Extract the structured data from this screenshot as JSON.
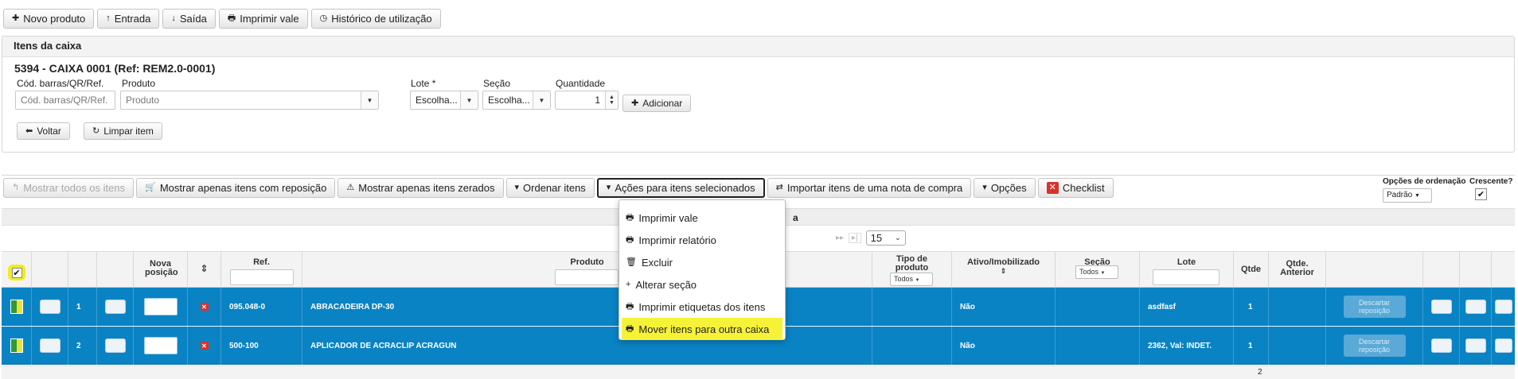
{
  "topbar": {
    "buttons": [
      {
        "icon": "plus-icon",
        "label": "Novo produto"
      },
      {
        "icon": "arrow-up-icon",
        "label": "Entrada"
      },
      {
        "icon": "arrow-down-icon",
        "label": "Saída"
      },
      {
        "icon": "printer-icon",
        "label": "Imprimir vale"
      },
      {
        "icon": "clock-icon",
        "label": "Histórico de utilização"
      }
    ]
  },
  "panel": {
    "title": "Itens da caixa",
    "box_title": "5394 - CAIXA 0001 (Ref: REM2.0-0001)",
    "barcode_label": "Cód. barras/QR/Ref.",
    "barcode_placeholder": "Cód. barras/QR/Ref.",
    "product_label": "Produto",
    "product_placeholder": "Produto",
    "lote_label": "Lote *",
    "lote_value": "Escolha...",
    "secao_label": "Seção",
    "secao_value": "Escolha...",
    "quantidade_label": "Quantidade",
    "quantidade_value": "1",
    "add_label": "Adicionar",
    "back_label": "Voltar",
    "clear_label": "Limpar item"
  },
  "toolbar": {
    "show_all": "Mostrar todos os itens",
    "show_replenish": "Mostrar apenas itens com reposição",
    "show_zero": "Mostrar apenas itens zerados",
    "order_items": "Ordenar itens",
    "actions": "Ações para itens selecionados",
    "import": "Importar itens de uma nota de compra",
    "options": "Opções",
    "checklist": "Checklist",
    "order_options_label": "Opções de ordenação",
    "order_options_value": "Padrão",
    "ascending_label": "Crescente?"
  },
  "menu": {
    "items": [
      {
        "icon": "printer-icon",
        "label": "Imprimir vale"
      },
      {
        "icon": "printer-icon",
        "label": "Imprimir relatório"
      },
      {
        "icon": "trash-icon",
        "label": "Excluir"
      },
      {
        "icon": "plus-icon",
        "label": "Alterar seção"
      },
      {
        "icon": "printer-icon",
        "label": "Imprimir etiquetas dos itens"
      },
      {
        "icon": "printer-icon",
        "label": "Mover itens para outra caixa"
      }
    ],
    "highlight_color": "#f6f238"
  },
  "grid": {
    "caption_fragment": "a",
    "page_size": "15",
    "columns": {
      "nova_posicao": "Nova posição",
      "ref": "Ref.",
      "produto": "Produto",
      "tipo": "Tipo de produto",
      "tipo_filter": "Todos",
      "ativo": "Ativo/Imobilizado",
      "secao": "Seção",
      "secao_filter": "Todos",
      "lote": "Lote",
      "qtde": "Qtde",
      "qtde_anterior": "Qtde. Anterior"
    },
    "rows": [
      {
        "num": "1",
        "ref": "095.048-0",
        "produto": "ABRACADEIRA DP-30",
        "ativo": "Não",
        "lote": "asdfasf",
        "qtde": "1",
        "discard": "Descartar reposição"
      },
      {
        "num": "2",
        "ref": "500-100",
        "produto": "APLICADOR DE ACRACLIP ACRAGUN",
        "ativo": "Não",
        "lote": "2362, Val: INDET.",
        "qtde": "1",
        "discard": "Descartar reposição"
      }
    ],
    "total_qtde": "2",
    "selected_row_color": "#0a83c4"
  }
}
